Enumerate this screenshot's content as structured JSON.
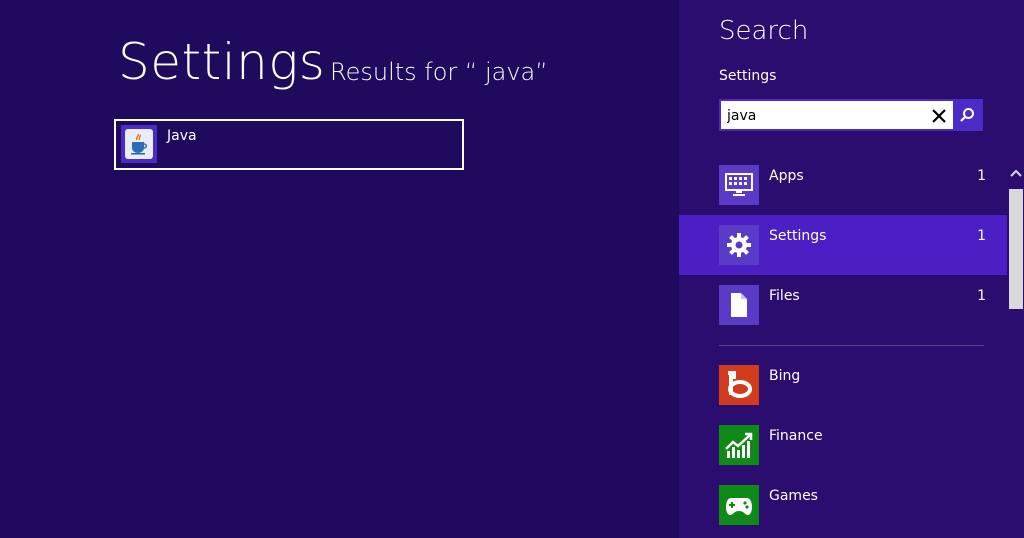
{
  "main": {
    "title": "Settings",
    "results_label": "Results for “ java”",
    "results": [
      {
        "label": "Java",
        "icon": "java-cup-icon"
      }
    ]
  },
  "search_pane": {
    "title": "Search",
    "scope": "Settings",
    "query": "java",
    "clear_icon": "close-icon",
    "search_icon": "search-icon",
    "categories": [
      {
        "label": "Apps",
        "count": "1",
        "icon": "keyboard-icon",
        "color": "#5a3bc8"
      },
      {
        "label": "Settings",
        "count": "1",
        "icon": "gear-icon",
        "color": "#5a3bc8",
        "selected": true
      },
      {
        "label": "Files",
        "count": "1",
        "icon": "file-icon",
        "color": "#5a3bc8"
      }
    ],
    "apps": [
      {
        "label": "Bing",
        "icon": "bing-icon",
        "color": "#d13c1e"
      },
      {
        "label": "Finance",
        "icon": "finance-chart-icon",
        "color": "#0f8a16"
      },
      {
        "label": "Games",
        "icon": "gamepad-icon",
        "color": "#0f8a16"
      }
    ]
  },
  "colors": {
    "background": "#1f0a5e",
    "pane": "#2a0d6e",
    "accent": "#4b2bc6",
    "selected_row": "#4c1fc4"
  }
}
